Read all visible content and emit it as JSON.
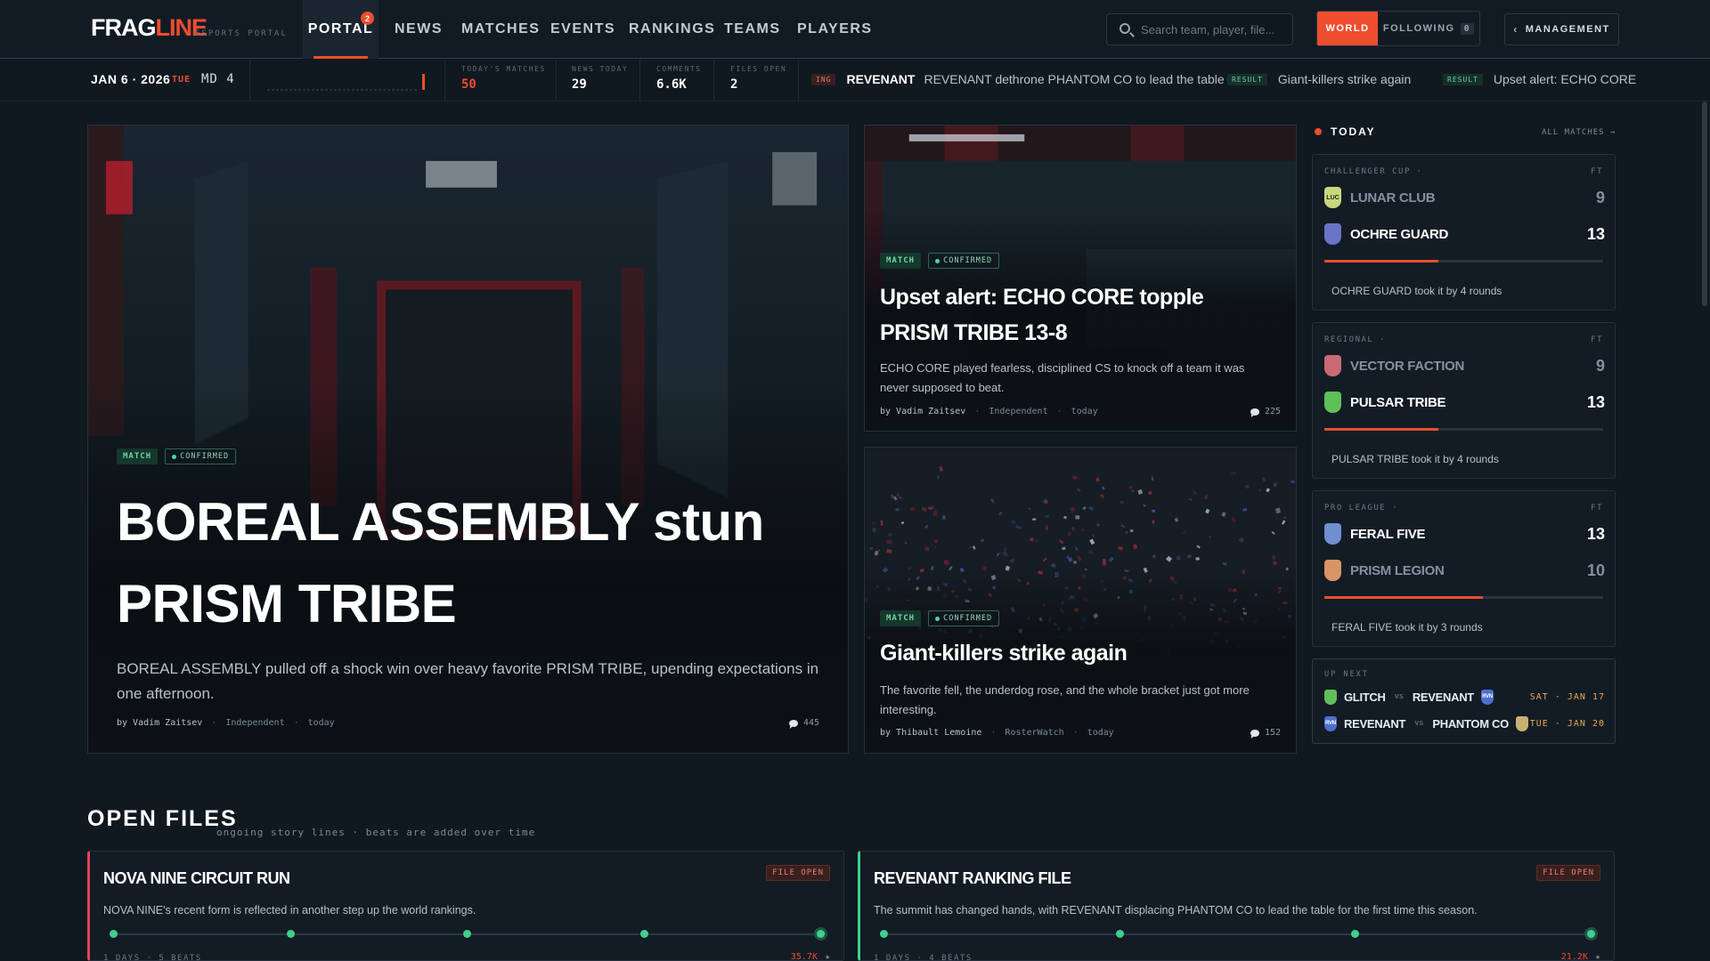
{
  "brand": {
    "logo_white": "FRAG",
    "logo_red": "LINE",
    "subtitle": "ESPORTS PORTAL"
  },
  "nav": {
    "items": [
      "PORTAL",
      "NEWS",
      "MATCHES",
      "EVENTS",
      "RANKINGS",
      "TEAMS",
      "PLAYERS"
    ],
    "active": "PORTAL",
    "portal_badge": "2"
  },
  "search": {
    "placeholder": "Search team, player, file..."
  },
  "scope": {
    "world": "WORLD",
    "following": "FOLLOWING",
    "following_count": "0"
  },
  "management": {
    "label": "MANAGEMENT",
    "icon": "chevron-left-icon"
  },
  "strip": {
    "date": "JAN 6 · 2026",
    "weekday": "TUE",
    "matchday": "MD 4",
    "stats": [
      {
        "label": "TODAY'S MATCHES",
        "value": "50",
        "accent": true
      },
      {
        "label": "NEWS TODAY",
        "value": "29"
      },
      {
        "label": "COMMENTS",
        "value": "6.6K"
      },
      {
        "label": "FILES OPEN",
        "value": "2"
      }
    ],
    "ticker": [
      {
        "tag": "ING",
        "team": "REVENANT",
        "text": "REVENANT dethrone PHANTOM CO to lead the table"
      },
      {
        "tag": "RESULT",
        "text": "Giant-killers strike again"
      },
      {
        "tag": "RESULT",
        "text": "Upset alert: ECHO CORE"
      }
    ]
  },
  "hero": {
    "badge_type": "MATCH",
    "badge_status": "CONFIRMED",
    "title": "BOREAL ASSEMBLY stun PRISM TRIBE",
    "desc": "BOREAL ASSEMBLY pulled off a shock win over heavy favorite PRISM TRIBE, upending expectations in one afternoon.",
    "author": "by Vadim Zaitsev",
    "source": "Independent",
    "time": "today",
    "comments": "445"
  },
  "story2": {
    "badge_type": "MATCH",
    "badge_status": "CONFIRMED",
    "title": "Upset alert: ECHO CORE topple PRISM TRIBE 13-8",
    "desc": "ECHO CORE played fearless, disciplined CS to knock off a team it was never supposed to beat.",
    "author": "by Vadim Zaitsev",
    "source": "Independent",
    "time": "today",
    "comments": "225"
  },
  "story3": {
    "badge_type": "MATCH",
    "badge_status": "CONFIRMED",
    "title": "Giant-killers strike again",
    "desc": "The favorite fell, the underdog rose, and the whole bracket just got more interesting.",
    "author": "by Thibault Lemoine",
    "source": "RosterWatch",
    "time": "today",
    "comments": "152"
  },
  "today": {
    "title": "TODAY",
    "all_matches": "ALL MATCHES →",
    "matches": [
      {
        "league": "CHALLENGER CUP ·",
        "status": "FT",
        "teams": [
          {
            "name": "LUNAR CLUB",
            "score": "9",
            "crest": "LUC",
            "color": "#c8d87a",
            "winner": false
          },
          {
            "name": "OCHRE GUARD",
            "score": "13",
            "crest": "",
            "color": "#6a74c9",
            "winner": true
          }
        ],
        "progress": 0.41,
        "note": "OCHRE GUARD took it by 4 rounds"
      },
      {
        "league": "REGIONAL ·",
        "status": "FT",
        "teams": [
          {
            "name": "VECTOR FACTION",
            "score": "9",
            "crest": "",
            "color": "#c96a72",
            "winner": false
          },
          {
            "name": "PULSAR TRIBE",
            "score": "13",
            "crest": "",
            "color": "#5fbf5a",
            "winner": true
          }
        ],
        "progress": 0.41,
        "note": "PULSAR TRIBE took it by 4 rounds"
      },
      {
        "league": "PRO LEAGUE ·",
        "status": "FT",
        "teams": [
          {
            "name": "FERAL FIVE",
            "score": "13",
            "crest": "",
            "color": "#6f8fd0",
            "winner": true
          },
          {
            "name": "PRISM LEGION",
            "score": "10",
            "crest": "",
            "color": "#d99466",
            "winner": false
          }
        ],
        "progress": 0.57,
        "note": "FERAL FIVE took it by 3 rounds"
      }
    ]
  },
  "upnext": {
    "title": "UP NEXT",
    "fixtures": [
      {
        "home": "GLITCH",
        "home_color": "#5fbf5a",
        "away": "REVENANT",
        "away_color": "#4d6fd0",
        "away_crest": "RVN",
        "vs": "vs",
        "when": "SAT · JAN 17"
      },
      {
        "home": "REVENANT",
        "home_color": "#4d6fd0",
        "home_crest": "RVN",
        "away": "PHANTOM CO",
        "away_color": "#c9b071",
        "vs": "vs",
        "when": "TUE · JAN 20"
      }
    ]
  },
  "open_files": {
    "title": "OPEN FILES",
    "subtitle": "ongoing story lines · beats are added over time",
    "files": [
      {
        "title": "NOVA NINE CIRCUIT RUN",
        "badge": "FILE OPEN",
        "accent": "#e0445f",
        "desc": "NOVA NINE's recent form is reflected in another step up the world rankings.",
        "beats": 5,
        "meta": "1 DAYS · 5 BEATS",
        "reads": "35.7K"
      },
      {
        "title": "REVENANT RANKING FILE",
        "badge": "FILE OPEN",
        "accent": "#3fcf8e",
        "desc": "The summit has changed hands, with REVENANT displacing PHANTOM CO to lead the table for the first time this season.",
        "beats": 4,
        "meta": "1 DAYS · 4 BEATS",
        "reads": "21.2K"
      }
    ]
  },
  "colors": {
    "accent": "#ef4d2f",
    "confirm": "#3fcf8e",
    "bg": "#101820"
  }
}
